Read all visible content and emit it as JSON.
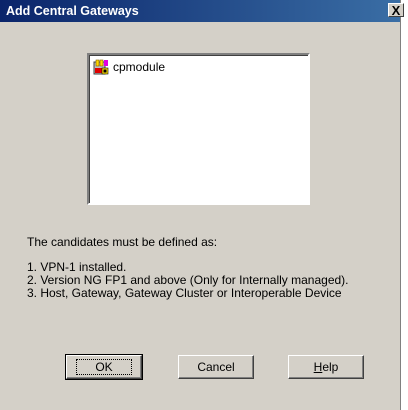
{
  "window": {
    "title": "Add Central Gateways",
    "close_glyph": "X"
  },
  "candidates_list": {
    "items": [
      {
        "label": "cpmodule",
        "icon": "check-point-module-icon"
      }
    ]
  },
  "info": {
    "intro": "The candidates must be defined as:",
    "rules": [
      "1. VPN-1 installed.",
      "2. Version NG FP1 and above (Only for Internally managed).",
      "3. Host, Gateway, Gateway Cluster or Interoperable Device"
    ]
  },
  "buttons": {
    "ok_label": "OK",
    "cancel_label": "Cancel",
    "help_label": "Help"
  }
}
